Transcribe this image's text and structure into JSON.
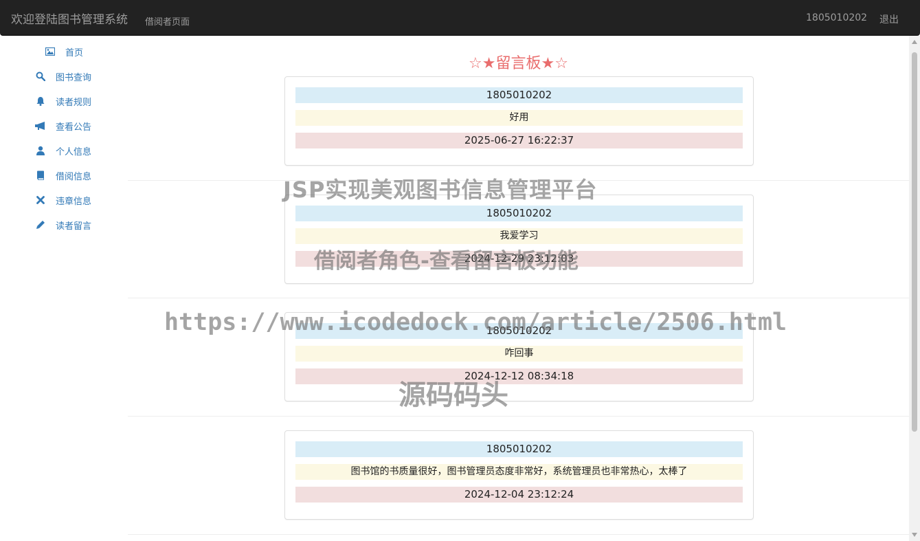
{
  "navbar": {
    "brand": "欢迎登陆图书管理系统",
    "subtitle": "借阅者页面",
    "user": "1805010202",
    "logout": "退出"
  },
  "sidebar": {
    "items": [
      {
        "label": "首页",
        "icon": "picture-icon"
      },
      {
        "label": "图书查询",
        "icon": "search-icon"
      },
      {
        "label": "读者规则",
        "icon": "bell-icon"
      },
      {
        "label": "查看公告",
        "icon": "bullhorn-icon"
      },
      {
        "label": "个人信息",
        "icon": "user-icon"
      },
      {
        "label": "借阅信息",
        "icon": "book-icon"
      },
      {
        "label": "违章信息",
        "icon": "remove-icon"
      },
      {
        "label": "读者留言",
        "icon": "pencil-icon"
      }
    ]
  },
  "board": {
    "title": "☆★留言板★☆",
    "messages": [
      {
        "user": "1805010202",
        "content": "好用",
        "time": "2025-06-27 16:22:37"
      },
      {
        "user": "1805010202",
        "content": "我爱学习",
        "time": "2024-12-29 23:12:03"
      },
      {
        "user": "1805010202",
        "content": "咋回事",
        "time": "2024-12-12 08:34:18"
      },
      {
        "user": "1805010202",
        "content": "图书馆的书质量很好，图书管理员态度非常好，系统管理员也非常热心，太棒了",
        "time": "2024-12-04 23:12:24"
      }
    ]
  },
  "watermarks": {
    "line1": "JSP实现美观图书信息管理平台",
    "line2": "借阅者角色-查看留言板功能",
    "line3": "https://www.icodedock.com/article/2506.html",
    "line4": "源码码头"
  },
  "colors": {
    "navbar_bg": "#222222",
    "link": "#337ab7",
    "title": "#e96d6d",
    "info_bg": "#d9edf7",
    "warning_bg": "#fcf8e3",
    "danger_bg": "#f2dede"
  }
}
